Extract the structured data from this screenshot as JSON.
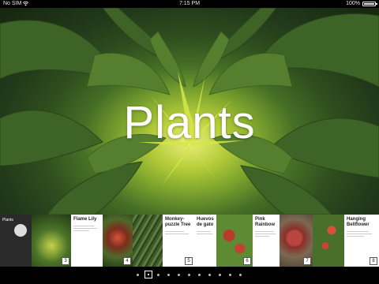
{
  "status_bar": {
    "carrier": "No SIM",
    "time": "7:15 PM",
    "battery_pct": "100%"
  },
  "hero": {
    "title": "Plants",
    "subject": "sunflower bud"
  },
  "thumbnails": [
    {
      "title": "Plants",
      "page": "",
      "kind": "cover"
    },
    {
      "title": "",
      "page": "3",
      "kind": "photo"
    },
    {
      "title": "Flame Lily",
      "page": "",
      "kind": "card"
    },
    {
      "title": "",
      "page": "4",
      "kind": "photo"
    },
    {
      "title": "",
      "page": "",
      "kind": "photo"
    },
    {
      "title": "Monkey-puzzle Tree",
      "page": "5",
      "kind": "card"
    },
    {
      "title": "Huevos de gato",
      "page": "",
      "kind": "card"
    },
    {
      "title": "",
      "page": "6",
      "kind": "photo"
    },
    {
      "title": "Pink Rainbow",
      "page": "",
      "kind": "card"
    },
    {
      "title": "",
      "page": "7",
      "kind": "photo"
    },
    {
      "title": "",
      "page": "",
      "kind": "photo"
    },
    {
      "title": "Hanging Bellflower",
      "page": "8",
      "kind": "card"
    }
  ],
  "page_control": {
    "count": 12,
    "active_index": 1
  },
  "colors": {
    "leaf": "#2f4f1e",
    "center": "#c6dc3a",
    "text": "#ffffff"
  }
}
